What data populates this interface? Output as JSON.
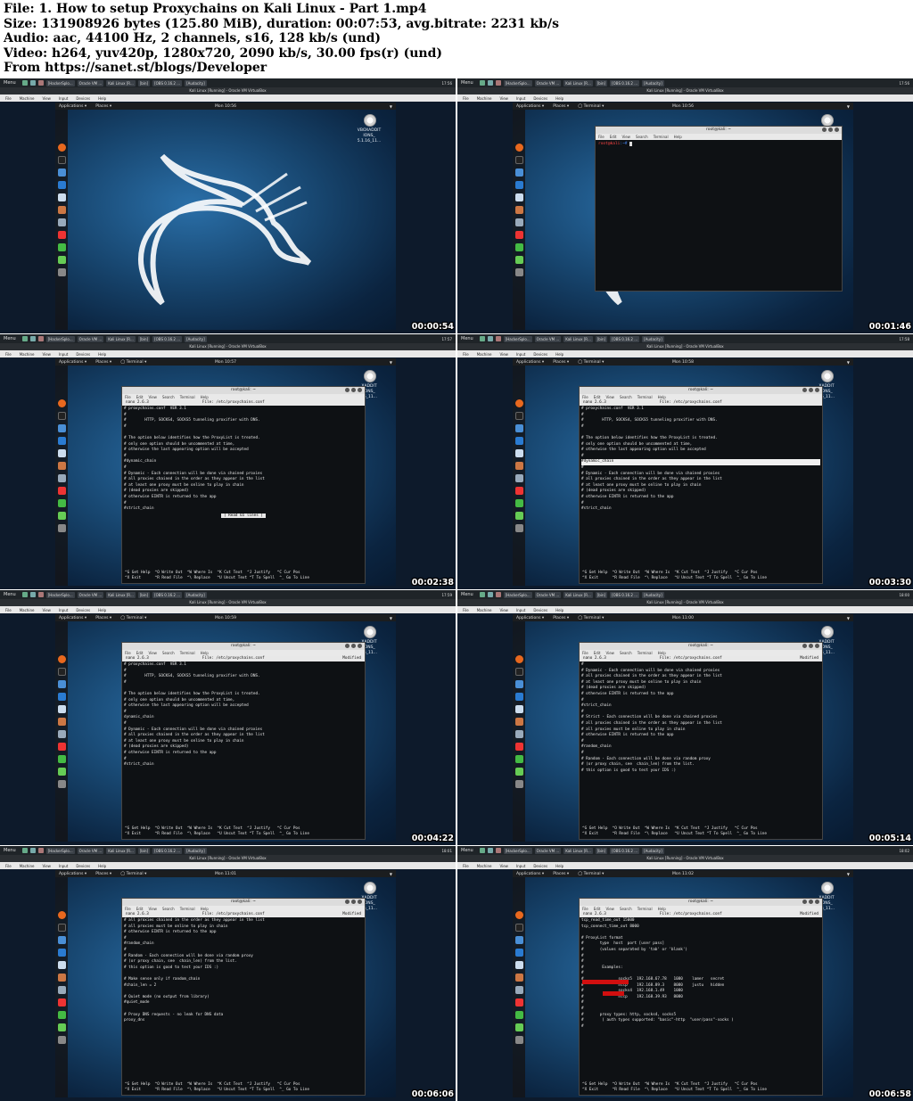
{
  "header": {
    "lines": [
      "File: 1. How to setup Proxychains on Kali Linux - Part 1.mp4",
      "Size: 131908926 bytes (125.80 MiB), duration: 00:07:53, avg.bitrate: 2231 kb/s",
      "Audio: aac, 44100 Hz, 2 channels, s16, 128 kb/s (und)",
      "Video: h264, yuv420p, 1280x720, 2090 kb/s, 30.00 fps(r) (und)",
      "From https://sanet.st/blogs/Developer"
    ]
  },
  "host": {
    "menu_label": "Menu",
    "tasks": [
      "[HackerSplo...",
      "Oracle VM ...",
      "Kali Linux [R...",
      "[bin]",
      "[OBS 0.16.2 ...",
      "[Audacity]"
    ],
    "window_title": "Kali Linux [Running] - Oracle VM VirtualBox",
    "vbox_menu": [
      "File",
      "Machine",
      "View",
      "Input",
      "Devices",
      "Help"
    ]
  },
  "guest": {
    "applications": "Applications ▾",
    "places": "Places ▾",
    "terminal_menu": "◯ Terminal ▾",
    "vbox_cd_label": "VBOXADDIT\nIONS_\n5.1.16_11...",
    "vbox_cd_label_short": "XADDIT\nIONS_\n16_11..."
  },
  "terminal": {
    "title": "root@kali: ~",
    "menu": [
      "File",
      "Edit",
      "View",
      "Search",
      "Terminal",
      "Help"
    ],
    "prompt_user": "root@kali",
    "prompt_suffix": ":~#"
  },
  "nano": {
    "version": "nano 2.6.3",
    "file": "File: /etc/proxychains.conf",
    "modified": "Modified",
    "status_read": "[ Read 65 lines ]",
    "footer_line1": "^G Get Help  ^O Write Out  ^W Where Is  ^K Cut Text  ^J Justify   ^C Cur Pos",
    "footer_line2": "^X Exit      ^R Read File  ^\\ Replace   ^U Uncut Text ^T To Spell  ^_ Go To Line"
  },
  "frames": [
    {
      "clock": "Mon 10:56",
      "time": "17:56",
      "timestamp": "00:00:54"
    },
    {
      "clock": "Mon 10:56",
      "time": "17:56",
      "timestamp": "00:01:46"
    },
    {
      "clock": "Mon 10:57",
      "time": "17:57",
      "timestamp": "00:02:38"
    },
    {
      "clock": "Mon 10:58",
      "time": "17:58",
      "timestamp": "00:03:30"
    },
    {
      "clock": "Mon 10:59",
      "time": "17:59",
      "timestamp": "00:04:22"
    },
    {
      "clock": "Mon 11:00",
      "time": "18:00",
      "timestamp": "00:05:14"
    },
    {
      "clock": "Mon 11:01",
      "time": "18:01",
      "timestamp": "00:06:06"
    },
    {
      "clock": "Mon 11:02",
      "time": "18:02",
      "timestamp": "00:06:58"
    }
  ],
  "file_views": {
    "a": "# proxychains.conf  VER 3.1\n#\n#        HTTP, SOCKS4, SOCKS5 tunneling proxifier with DNS.\n#\n\n# The option below identifies how the ProxyList is treated.\n# only one option should be uncommented at time,\n# otherwise the last appearing option will be accepted\n#\n#dynamic_chain\n#\n# Dynamic - Each connection will be done via chained proxies\n# all proxies chained in the order as they appear in the list\n# at least one proxy must be online to play in chain\n# (dead proxies are skipped)\n# otherwise EINTR is returned to the app\n#\n#strict_chain",
    "b_pre": "# proxychains.conf  VER 3.1\n#\n#        HTTP, SOCKS4, SOCKS5 tunneling proxifier with DNS.\n#\n\n# The option below identifies how the ProxyList is treated.\n# only one option should be uncommented at time,\n# otherwise the last appearing option will be accepted\n#",
    "b_hl": "#dynamic_chain",
    "b_post": "#\n# Dynamic - Each connection will be done via chained proxies\n# all proxies chained in the order as they appear in the list\n# at least one proxy must be online to play in chain\n# (dead proxies are skipped)\n# otherwise EINTR is returned to the app\n#\n#strict_chain",
    "c": "# proxychains.conf  VER 3.1\n#\n#        HTTP, SOCKS4, SOCKS5 tunneling proxifier with DNS.\n#\n\n# The option below identifies how the ProxyList is treated.\n# only one option should be uncommented at time,\n# otherwise the last appearing option will be accepted\n#\ndynamic_chain\n#\n# Dynamic - Each connection will be done via chained proxies\n# all proxies chained in the order as they appear in the list\n# at least one proxy must be online to play in chain\n# (dead proxies are skipped)\n# otherwise EINTR is returned to the app\n#\n#strict_chain",
    "d": "#\n# Dynamic - Each connection will be done via chained proxies\n# all proxies chained in the order as they appear in the list\n# at least one proxy must be online to play in chain\n# (dead proxies are skipped)\n# otherwise EINTR is returned to the app\n#\n#strict_chain\n#\n# Strict - Each connection will be done via chained proxies\n# all proxies chained in the order as they appear in the list\n# all proxies must be online to play in chain\n# otherwise EINTR is returned to the app\n#\n#random_chain\n#\n# Random - Each connection will be done via random proxy\n# (or proxy chain, see  chain_len) from the list.\n# this option is good to test your IDS :)",
    "e": "# all proxies chained in the order as they appear in the list\n# all proxies must be online to play in chain\n# otherwise EINTR is returned to the app\n#\n#random_chain\n#\n# Random - Each connection will be done via random proxy\n# (or proxy chain, see  chain_len) from the list.\n# this option is good to test your IDS :)\n\n# Make sense only if random_chain\n#chain_len = 2\n\n# Quiet mode (no output from library)\n#quiet_mode\n\n# Proxy DNS requests - no leak for DNS data\nproxy_dns",
    "f": "tcp_read_time_out 15000\ntcp_connect_time_out 8000\n\n# ProxyList format\n#       type  host  port [user pass]\n#       (values separated by 'tab' or 'blank')\n#\n#\n#        Examples:\n#\n#               socks5  192.168.67.78   1080    lamer   secret\n#               http    192.168.89.3    8080    justu   hidden\n#               socks4  192.168.1.49    1080\n#               http    192.168.39.93   8080\n#\n#\n#       proxy types: http, socks4, socks5\n#        ( auth types supported: \"basic\"-http  \"user/pass\"-socks )\n#"
  }
}
